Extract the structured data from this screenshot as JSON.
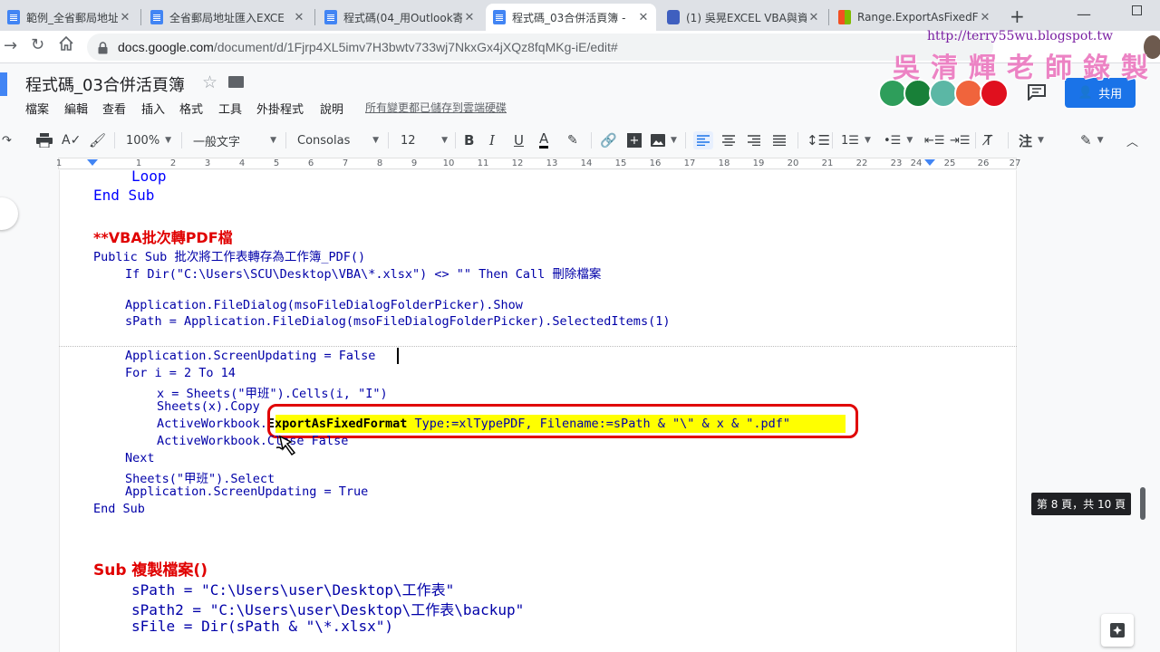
{
  "browser": {
    "tabs": [
      {
        "label": "範例_全省郵局地址 - Go",
        "icon": "docs-icon",
        "active": false
      },
      {
        "label": "全省郵局地址匯入EXCE",
        "icon": "docs-icon",
        "active": false
      },
      {
        "label": "程式碼(04_用Outlook寄",
        "icon": "docs-icon",
        "active": false
      },
      {
        "label": "程式碼_03合併活頁簿 -",
        "icon": "docs-icon",
        "active": true
      },
      {
        "label": "(1) 吳晃EXCEL VBA與資",
        "icon": "video-icon",
        "active": false
      },
      {
        "label": "Range.ExportAsFixedF",
        "icon": "microsoft-icon",
        "active": false
      }
    ],
    "url_host": "docs.google.com",
    "url_path": "/document/d/1Fjrp4XL5imv7H3bwtv733wj7NkxGx4jXQz8fqMKg-iE/edit#"
  },
  "watermark": {
    "url": "http://terry55wu.blogspot.tw",
    "name": "吳清輝老師錄製"
  },
  "docs": {
    "title": "程式碼_03合併活頁簿",
    "menus": [
      "檔案",
      "編輯",
      "查看",
      "插入",
      "格式",
      "工具",
      "外掛程式",
      "說明"
    ],
    "save_status": "所有變更都已儲存到雲端硬碟",
    "share_label": "共用",
    "toolbar": {
      "zoom": "100%",
      "style": "一般文字",
      "font": "Consolas",
      "size": "12"
    },
    "ruler_numbers": [
      "1",
      "1",
      "2",
      "3",
      "4",
      "5",
      "6",
      "7",
      "8",
      "9",
      "10",
      "11",
      "12",
      "13",
      "14",
      "15",
      "16",
      "17",
      "18",
      "19",
      "20",
      "21",
      "22",
      "23",
      "24",
      "25",
      "26",
      "27"
    ],
    "page_indicator": "第 8 頁，共 10 頁",
    "colors": {
      "keyword": "#0000ff",
      "heading": "#e00000",
      "highlight": "#ffff00",
      "string": "#a31515"
    }
  },
  "content": {
    "line1": "Loop",
    "line2": "End Sub",
    "heading1": "**VBA批次轉PDF檔",
    "line3": "Public Sub 批次將工作表轉存為工作簿_PDF()",
    "line4": "If Dir(\"C:\\Users\\SCU\\Desktop\\VBA\\*.xlsx\") <> \"\" Then Call 刪除檔案",
    "line5": "Application.FileDialog(msoFileDialogFolderPicker).Show",
    "line6": "sPath = Application.FileDialog(msoFileDialogFolderPicker).SelectedItems(1)",
    "line7": "Application.ScreenUpdating = False",
    "line8": "For i = 2 To 14",
    "line9": "x = Sheets(\"甲班\").Cells(i, \"I\")",
    "line10": "Sheets(x).Copy",
    "line11_prefix": "ActiveWorkbook.",
    "line11_method": "ExportAsFixedFormat",
    "line11_rest": " Type:=xlTypePDF, Filename:=sPath & \"\\\" & x & \".pdf\"",
    "line12": "ActiveWorkbook.Close False",
    "line13": "Next",
    "line14": "Sheets(\"甲班\").Select",
    "line15": "Application.ScreenUpdating = True",
    "line16": "End Sub",
    "heading2": "Sub 複製檔案()",
    "line17": "sPath = \"C:\\Users\\user\\Desktop\\工作表\"",
    "line18": "sPath2 = \"C:\\Users\\user\\Desktop\\工作表\\backup\"",
    "line19": "sFile = Dir(sPath & \"\\*.xlsx\")"
  }
}
